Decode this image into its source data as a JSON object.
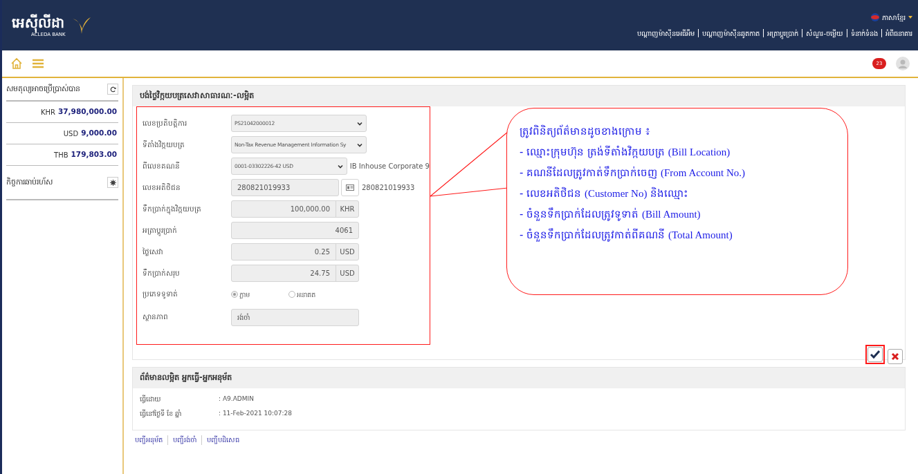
{
  "header": {
    "logo_text": "អេស៊ីលីដា",
    "logo_subtext": "ACLEDA BANK",
    "language": "ភាសាខ្មែរ",
    "nav": [
      "បណ្ដាញម៉ាស៊ីនអេធីអឹម",
      "បណ្ដាញម៉ាស៊ីនឆូតកាត",
      "អត្រាប្ដូរប្រាក់",
      "សំណួរ-ចម្លើយ",
      "ទំនាក់ទំនង",
      "អំពីធនាគារ"
    ]
  },
  "toolbar": {
    "notification_count": "23"
  },
  "sidebar": {
    "balance_title": "សមតុល្យអាចប្រើប្រាស់បាន",
    "balances": [
      {
        "currency": "KHR",
        "amount": "37,980,000.00"
      },
      {
        "currency": "USD",
        "amount": "9,000.00"
      },
      {
        "currency": "THB",
        "amount": "179,803.00"
      }
    ],
    "quick_title": "កិច្ចការឆាប់រហ័ស"
  },
  "form": {
    "title": "បង់ថ្លៃវិក្កយបត្រសេវាសាធារណៈ-លម្អិត",
    "fields": [
      {
        "kind": "select",
        "label": "លេខប្រតិបត្តិការ",
        "value": "PS21042000012"
      },
      {
        "kind": "select",
        "label": "ទីតាំងវិក្កយបត្រ",
        "value": "Non-Tax Revenue Management Information Sy"
      },
      {
        "kind": "select",
        "label": "ពីលេខគណនី",
        "value": "0001-03302226-42 USD",
        "note": "IB Inhouse Corporate 9"
      },
      {
        "kind": "lookup",
        "label": "លេខអតិថិជន",
        "value": "280821019933",
        "note": "280821019933"
      },
      {
        "kind": "amount",
        "label": "ទឹកប្រាក់ក្នុងវិក្កយបត្រ",
        "value": "100,000.00",
        "unit": "KHR"
      },
      {
        "kind": "amount",
        "label": "អត្រាប្ដូរប្រាក់",
        "value": "4061"
      },
      {
        "kind": "amount",
        "label": "ថ្លៃសេវា",
        "value": "0.25",
        "unit": "USD"
      },
      {
        "kind": "amount",
        "label": "ទឹកប្រាក់សរុប",
        "value": "24.75",
        "unit": "USD"
      },
      {
        "kind": "radio",
        "label": "ប្រភេទទូទាត់",
        "options": [
          {
            "label": "ភ្លាម",
            "selected": true
          },
          {
            "label": "អនាគត",
            "selected": false
          }
        ]
      },
      {
        "kind": "text",
        "label": "ស្ថានភាព",
        "value": "រង់ចាំ"
      }
    ]
  },
  "callout": {
    "heading": "ត្រូវពិនិត្យព័ត៌មានដូចខាងក្រោម ៖",
    "items": [
      {
        "khmer": "- ឈ្មោះក្រុមហ៊ុន ត្រង់ទីតាំងវិក្កយបត្រ",
        "english": "(Bill Location)"
      },
      {
        "khmer": "- គណនីដែលត្រូវកាត់ទឹកប្រាក់ចេញ",
        "english": "(From Account No.)"
      },
      {
        "khmer": "- លេខអតិថិជន",
        "english": "(Customer No)",
        "after": "និងឈ្មោះ"
      },
      {
        "khmer": "- ចំនួនទឹកប្រាក់ដែលត្រូវទូទាត់",
        "english": "(Bill Amount)"
      },
      {
        "khmer": "- ចំនួនទឹកប្រាក់ដែលត្រូវកាត់ពីគណនី",
        "english": "(Total Amount)"
      }
    ]
  },
  "details": {
    "title": "ព័ត៌មានលម្អិត អ្នកធ្វើ-អ្នកអនុម័ត",
    "rows": [
      {
        "label": "ធ្វើដោយ",
        "value": ": A9.ADMIN"
      },
      {
        "label": "ធ្វើនៅថ្ងៃទី ខែ ឆ្នាំ",
        "value": ": 11-Feb-2021 10:07:28"
      }
    ]
  },
  "links": [
    "បញ្ជីអនុម័ត",
    "បញ្ជីរង់ចាំ",
    "បញ្ជីបដិសេធ"
  ]
}
